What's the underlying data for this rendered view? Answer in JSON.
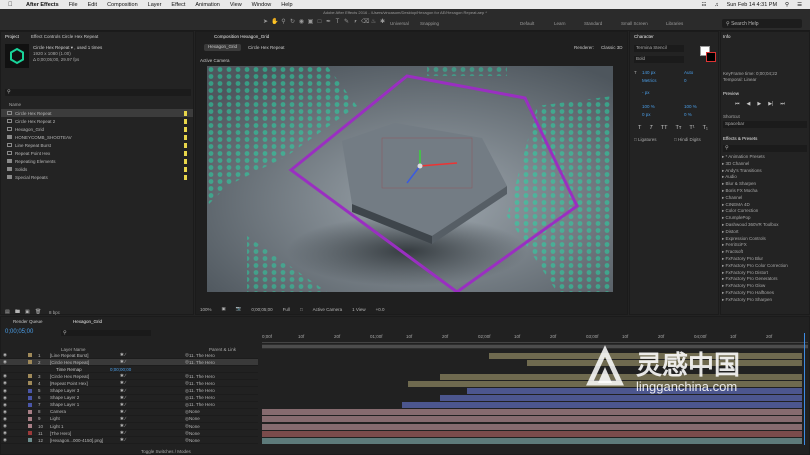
{
  "menubar": {
    "app": "After Effects",
    "items": [
      "File",
      "Edit",
      "Composition",
      "Layer",
      "Effect",
      "Animation",
      "View",
      "Window",
      "Help"
    ],
    "datetime": "Sun Feb 14  4:31 PM"
  },
  "title": "Adobe After Effects 2016 - /Users/vincasom/Desktop/Hexagon for AE/Hexagon Repeat.aep *",
  "toolbar": {
    "universal": "Universal",
    "snapping": "Snapping",
    "workspaces": [
      "Default",
      "Learn",
      "Standard",
      "Small Screen",
      "Libraries"
    ],
    "search": "Search Help"
  },
  "project": {
    "tab": "Project",
    "tab2": "Effect Controls Circle Hex Repeat",
    "selected_name": "Circle Hex Repeat ▾ , used 1 times",
    "selected_info": "1920 x 1080 (1.00)",
    "selected_dur": "Δ 0;00;05;00, 29.97 fps",
    "search": "",
    "col_name": "Name",
    "items": [
      {
        "name": "Circle Hex Repeat",
        "type": "comp",
        "color": "#e8d64a",
        "selected": true
      },
      {
        "name": "Circle Hex Repeat 2",
        "type": "comp",
        "color": "#e8d64a"
      },
      {
        "name": "Hexagon_Grid",
        "type": "comp",
        "color": "#e8d64a"
      },
      {
        "name": "HONEYCOMB_SHOOTEAV",
        "type": "folder",
        "color": "#e8d64a"
      },
      {
        "name": "Line Repeat Burst",
        "type": "comp",
        "color": "#e8d64a"
      },
      {
        "name": "Repeat Point Hex",
        "type": "comp",
        "color": "#e8d64a"
      },
      {
        "name": "Repeating Elements",
        "type": "folder",
        "color": "#e8d64a"
      },
      {
        "name": "Solids",
        "type": "folder",
        "color": "#e8d64a"
      },
      {
        "name": "Special Repeats",
        "type": "folder",
        "color": "#e8d64a"
      }
    ],
    "bpc": "8 bpc"
  },
  "composition": {
    "tab": "Composition Hexagon_Grid",
    "crumb1": "Hexagon_Grid",
    "crumb2": "Circle Hex Repeat",
    "renderer_label": "Renderer:",
    "renderer": "Classic 3D",
    "camera_label": "Active Camera",
    "zoom": "100%",
    "time": "0;00;05;00",
    "quality": "Full",
    "view_camera": "Active Camera",
    "views": "1 View",
    "offset": "+0.0"
  },
  "character": {
    "tab": "Character",
    "font": "Termina Stencil",
    "style": "Bold",
    "size": "140 px",
    "leading": "Auto",
    "kerning": "Metrics",
    "tracking": "0",
    "stroke": "- px",
    "vscale": "100 %",
    "hscale": "100 %",
    "baseline": "0 px",
    "tsume": "0 %",
    "ligatures": "Ligatures",
    "hindi": "Hindi Digits"
  },
  "info": {
    "tab": "Info",
    "line1": "KeyFrame time: 0;00;04;22",
    "line2": "Temporal: Linear"
  },
  "preview": {
    "tab": "Preview"
  },
  "shortcut": {
    "label": "Shortcut",
    "value": "Spacebar"
  },
  "effects": {
    "tab": "Effects & Presets",
    "items": [
      "* Animation Presets",
      "3D Channel",
      "Andy's Transitions",
      "Audio",
      "Blur & Sharpen",
      "Boris FX Mocha",
      "Channel",
      "CINEMA 4D",
      "Color Correction",
      "CrumplePop",
      "Dashwood 360VR Toolbox",
      "Distort",
      "Expression Controls",
      "FerriSciFX",
      "Fractsoft",
      "FxFactory Pro Blur",
      "FxFactory Pro Color Correction",
      "FxFactory Pro Distort",
      "FxFactory Pro Generators",
      "FxFactory Pro Glow",
      "FxFactory Pro Halftones",
      "FxFactory Pro Sharpen"
    ]
  },
  "timeline": {
    "tab1": "Render Queue",
    "tab2": "Hexagon_Grid",
    "timecode": "0;00;05;00",
    "search": "",
    "col_layer": "Layer Name",
    "col_parent": "Parent & Link",
    "ticks": [
      "0;00f",
      "10f",
      "20f",
      "01;00f",
      "10f",
      "20f",
      "02;00f",
      "10f",
      "20f",
      "03;00f",
      "10f",
      "20f",
      "04;00f",
      "10f",
      "20f"
    ],
    "layers": [
      {
        "num": "1",
        "name": "[Line Repeat Burst]",
        "parent": "11. The Hero",
        "color": "#a08a5a",
        "bar_start": 0.42,
        "bar_color": "#6f6a4f"
      },
      {
        "num": "2",
        "name": "[Circle Hex Repeat]",
        "parent": "11. The Hero",
        "color": "#a08a5a",
        "bar_start": 0.49,
        "bar_color": "#6f6a4f",
        "selected": true
      },
      {
        "num": "",
        "name": "Time Remap",
        "parent": "",
        "color": "",
        "sub": true,
        "value": "0;00;00;00"
      },
      {
        "num": "3",
        "name": "[Circle Hex Repeat]",
        "parent": "11. The Hero",
        "color": "#a08a5a",
        "bar_start": 0.33,
        "bar_color": "#6f6a4f"
      },
      {
        "num": "4",
        "name": "[Repeat Point Hex]",
        "parent": "11. The Hero",
        "color": "#a08a5a",
        "bar_start": 0.27,
        "bar_color": "#6f6a4f"
      },
      {
        "num": "5",
        "name": "Shape Layer 3",
        "parent": "11. The Hero",
        "color": "#4a56a8",
        "bar_start": 0.38,
        "bar_color": "#4c568e"
      },
      {
        "num": "6",
        "name": "Shape Layer 2",
        "parent": "11. The Hero",
        "color": "#4a56a8",
        "bar_start": 0.33,
        "bar_color": "#4c568e"
      },
      {
        "num": "7",
        "name": "Shape Layer 1",
        "parent": "11. The Hero",
        "color": "#4a56a8",
        "bar_start": 0.26,
        "bar_color": "#4c568e"
      },
      {
        "num": "8",
        "name": "Camera",
        "parent": "None",
        "color": "#a87f86",
        "bar_start": 0.0,
        "bar_color": "#866b6f"
      },
      {
        "num": "9",
        "name": "Light",
        "parent": "None",
        "color": "#a87f86",
        "bar_start": 0.0,
        "bar_color": "#866b6f"
      },
      {
        "num": "10",
        "name": "Light 1",
        "parent": "None",
        "color": "#a87f86",
        "bar_start": 0.0,
        "bar_color": "#866b6f"
      },
      {
        "num": "11",
        "name": "[The Hero]",
        "parent": "None",
        "color": "#9c3a3a",
        "bar_start": 0.0,
        "bar_color": "#7a4b4b"
      },
      {
        "num": "12",
        "name": "[Hexagon...000-4150].png]",
        "parent": "None",
        "color": "#6d8d8d",
        "bar_start": 0.0,
        "bar_color": "#5d7a7a"
      }
    ],
    "toggle": "Toggle Switches / Modes"
  },
  "watermark": {
    "cn": "灵感中国",
    "en": "lingganchina.com"
  }
}
